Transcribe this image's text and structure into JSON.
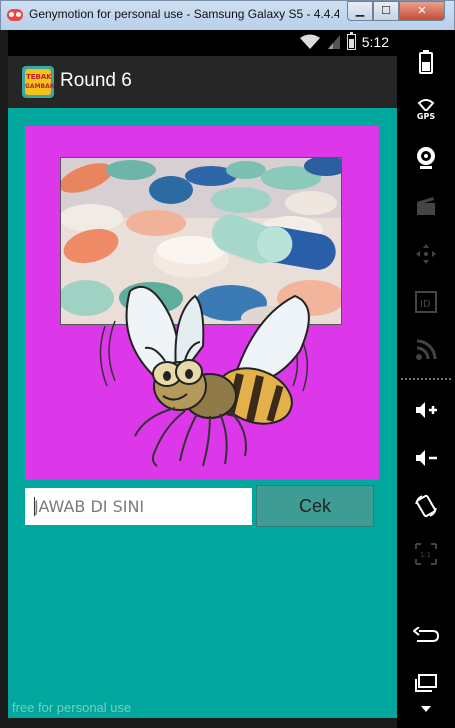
{
  "window": {
    "title": "Genymotion for personal use - Samsung Galaxy S5 - 4.4.4...",
    "minimize_label": "▁",
    "maximize_label": "☐",
    "close_label": "✕"
  },
  "statusbar": {
    "time": "5:12",
    "icons": [
      "wifi-icon",
      "signal-icon",
      "battery-icon"
    ]
  },
  "actionbar": {
    "app_icon": "tebak-gambar-logo",
    "title": "Round 6"
  },
  "puzzle": {
    "images": [
      "pills-photo",
      "bee-cartoon"
    ],
    "background_color": "#dc37e8"
  },
  "answer": {
    "placeholder": "JAWAB DI SINI",
    "value": "",
    "button_label": "Cek"
  },
  "watermark": "free for personal use",
  "sidebar": {
    "gps_label": "GPS",
    "id_label": "ID",
    "items": [
      "battery-icon",
      "gps-icon",
      "camera-icon",
      "clapper-icon",
      "dpad-icon",
      "id-icon",
      "rss-icon",
      "volume-up-icon",
      "volume-down-icon",
      "rotate-icon",
      "scale-icon",
      "back-icon",
      "recent-apps-icon"
    ]
  },
  "colors": {
    "app_background": "#01a79d",
    "button": "#3e9c95",
    "actionbar": "#262626"
  }
}
